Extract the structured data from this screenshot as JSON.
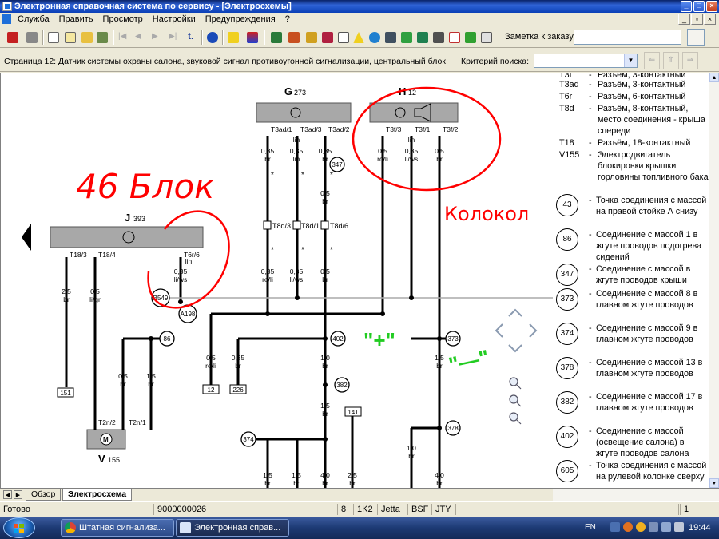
{
  "window": {
    "title": "Электронная справочная система по сервису - [Электросхемы]"
  },
  "menu": [
    "Служба",
    "Править",
    "Просмотр",
    "Настройки",
    "Предупреждения",
    "?"
  ],
  "toolbar": {
    "order_label": "Заметка к заказу:",
    "order_value": ""
  },
  "infobar": {
    "page_title": "Страница 12: Датчик системы охраны салона, звуковой сигнал противоугонной сигнализации, центральный блок",
    "search_label": "Критерий поиска:",
    "search_value": ""
  },
  "diagram": {
    "components": {
      "g": {
        "letter": "G",
        "num": "273"
      },
      "h": {
        "letter": "H",
        "num": "12"
      },
      "j": {
        "letter": "J",
        "num": "393"
      },
      "v": {
        "letter": "V",
        "num": "155"
      }
    },
    "pins": {
      "g1": "T3ad/1",
      "g2": "T3ad/3",
      "g3": "T3ad/2",
      "h1": "T3f/3",
      "h2": "T3f/1",
      "h3": "T3f/2",
      "j1": "T18/3",
      "j2": "T18/4",
      "j3": "T6r/6",
      "v1": "T2n/2",
      "v2": "T2n/1",
      "c1": "T8d/3",
      "c2": "T8d/1",
      "c3": "T8d/6"
    },
    "wires": {
      "g1_size": "0,35",
      "g1_color": "br",
      "g2_size": "0,35",
      "g2_color": "lin",
      "g3_size": "0,35",
      "g3_color": "br",
      "g2_lin": "lin",
      "h1_size": "0,5",
      "h1_color": "ro/li",
      "h2_size": "0,35",
      "h2_color": "li/ws",
      "h3_size": "0,5",
      "h3_color": "br",
      "h2_lin": "lin",
      "g3_mid_size": "0,5",
      "g3_mid_color": "br",
      "c1_size": "0,35",
      "c1_color": "ro/li",
      "c2_size": "0,35",
      "c2_color": "li/ws",
      "c3_size": "0,5",
      "c3_color": "br",
      "j1_size": "2,5",
      "j1_color": "br",
      "j2_size": "0,5",
      "j2_color": "li/gr",
      "j3_lin": "lin",
      "j3_size": "0,35",
      "j3_color": "li/ws",
      "a1_size": "0,5",
      "a1_color": "ro/li",
      "a2_size": "0,35",
      "a2_color": "br",
      "m1_size": "1,0",
      "m1_color": "br",
      "m2_size": "1,5",
      "m2_color": "br",
      "r1_size": "1,5",
      "r1_color": "br",
      "r2_size": "1,0",
      "r2_color": "br",
      "v1_size": "0,5",
      "v1_color": "br",
      "v2_size": "1,5",
      "v2_color": "br",
      "b1_size": "1,5",
      "b1_color": "br",
      "b2_size": "1,5",
      "b2_color": "br",
      "b3_size": "4,0",
      "b3_color": "br",
      "b4_size": "2,5",
      "b4_color": "br",
      "b5_size": "4,0",
      "b5_color": "br"
    },
    "connectors": {
      "b549": "B549",
      "a198": "A198",
      "n347": "347",
      "n86": "86",
      "n402": "402",
      "n382": "382",
      "n373": "373",
      "n378": "378",
      "n374": "374",
      "t151": "151",
      "t12": "12",
      "t226": "226",
      "t141": "141"
    },
    "annotations": {
      "block": "46 Блок",
      "bell": "Колокол",
      "plus": "\"+\"",
      "minus": "\"—\""
    }
  },
  "legend": [
    {
      "code": "T3f",
      "text": "Разъём, 3-контактный"
    },
    {
      "code": "T3ad",
      "text": "Разъём, 3-контактный"
    },
    {
      "code": "T6r",
      "text": "Разъём, 6-контактный"
    },
    {
      "code": "T8d",
      "text": "Разъём, 8-контактный, место соединения - крыша спереди"
    },
    {
      "code": "T18",
      "text": "Разъём, 18-контактный"
    },
    {
      "code": "V155",
      "text": "Электродвигатель блокировки крышки горловины топливного бака"
    }
  ],
  "legend_circles": [
    {
      "num": "43",
      "text": "Точка соединения с массой на правой стойке А снизу"
    },
    {
      "num": "86",
      "text": "Соединение с массой 1 в жгуте проводов подогрева сидений"
    },
    {
      "num": "347",
      "text": "Соединение с массой в жгуте проводов крыши"
    },
    {
      "num": "373",
      "text": "Соединение с массой 8 в главном жгуте проводов"
    },
    {
      "num": "374",
      "text": "Соединение с массой 9 в главном жгуте проводов"
    },
    {
      "num": "378",
      "text": "Соединение с массой 13 в главном жгуте проводов"
    },
    {
      "num": "382",
      "text": "Соединение с массой 17 в главном жгуте проводов"
    },
    {
      "num": "402",
      "text": "Соединение с массой (освещение салона) в жгуте проводов салона"
    },
    {
      "num": "605",
      "text": "Точка соединения с массой на рулевой колонке сверху"
    }
  ],
  "tabs": [
    "Обзор",
    "Электросхема"
  ],
  "status": {
    "ready": "Готово",
    "code": "9000000026",
    "f1": "8",
    "f2": "1K2",
    "f3": "Jetta",
    "f4": "BSF",
    "f5": "JTY",
    "f6": "1"
  },
  "taskbar": {
    "task1": "Штатная сигнализа...",
    "task2": "Электронная справ...",
    "lang": "EN",
    "clock": "19:44"
  },
  "colors": {
    "annotation_red": "#ff0000",
    "annotation_green": "#22cc22",
    "component_fill": "#a8a8a8"
  }
}
